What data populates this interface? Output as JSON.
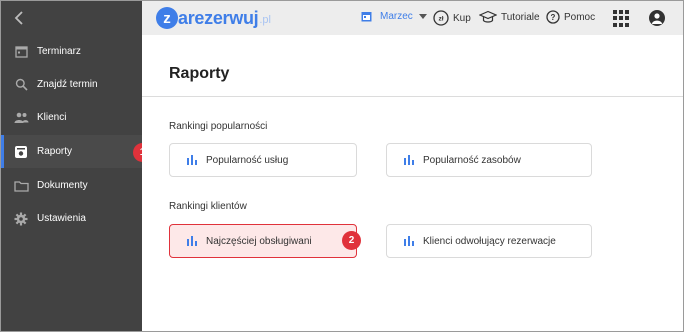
{
  "topbar": {
    "logo_letter": "z",
    "logo_text": "arezerwuj",
    "logo_suffix": ".pl",
    "month_label": "Marzec",
    "buy_label": "Kup",
    "tutorials_label": "Tutoriale",
    "help_label": "Pomoc",
    "accent_color": "#3f7ee8"
  },
  "sidebar": {
    "items": [
      {
        "label": "Terminarz",
        "icon": "calendar-icon"
      },
      {
        "label": "Znajdź termin",
        "icon": "search-icon"
      },
      {
        "label": "Klienci",
        "icon": "people-icon"
      },
      {
        "label": "Raporty",
        "icon": "report-icon",
        "active": true
      },
      {
        "label": "Dokumenty",
        "icon": "folder-icon"
      },
      {
        "label": "Ustawienia",
        "icon": "gear-icon"
      }
    ]
  },
  "main": {
    "title": "Raporty",
    "sections": [
      {
        "title": "Rankingi popularności",
        "cards": [
          "Popularność usług",
          "Popularność zasobów"
        ]
      },
      {
        "title": "Rankingi klientów",
        "cards": [
          "Najczęściej obsługiwani",
          "Klienci odwołujący rezerwacje"
        ]
      }
    ]
  },
  "annotations": {
    "badge1": "1",
    "badge2": "2",
    "highlight_color": "#e0323b"
  }
}
